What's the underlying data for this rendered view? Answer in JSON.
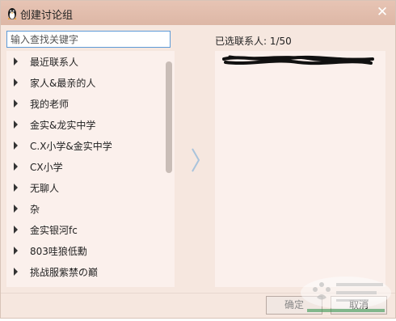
{
  "window": {
    "title": "创建讨论组",
    "close_glyph": "✕"
  },
  "search": {
    "placeholder": "输入查找关键字",
    "value": ""
  },
  "groups": [
    {
      "label": "最近联系人"
    },
    {
      "label": "家人&最亲的人"
    },
    {
      "label": "我的老师"
    },
    {
      "label": "金实&龙实中学"
    },
    {
      "label": "C.X小学&金实中学"
    },
    {
      "label": "CX小学"
    },
    {
      "label": "无聊人"
    },
    {
      "label": "杂"
    },
    {
      "label": "金实银河fc"
    },
    {
      "label": "803哇狼低勳"
    },
    {
      "label": "挑战服紫禁の巅"
    }
  ],
  "selected": {
    "label": "已选联系人: 1/50"
  },
  "buttons": {
    "ok": "确定",
    "cancel": "取消"
  },
  "icons": {
    "title": "qq-penguin-icon",
    "transfer": "chevron-right-icon",
    "close": "close-icon"
  },
  "colors": {
    "titlebar": "#e2bcab",
    "panel": "#fbf0ec",
    "dialog": "#f6e7df",
    "focus": "#5d9bd8"
  }
}
